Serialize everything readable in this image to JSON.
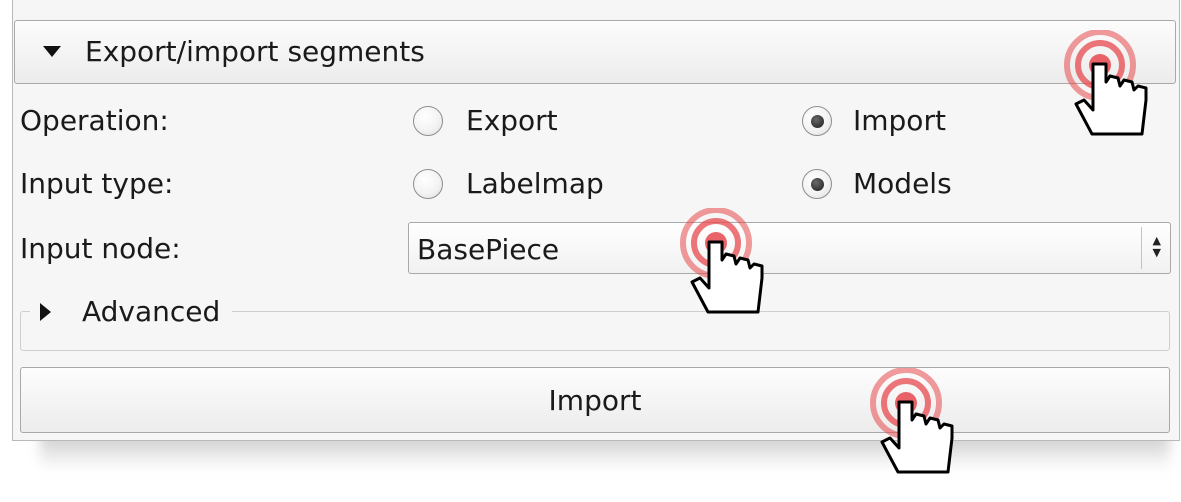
{
  "section": {
    "title": "Export/import segments"
  },
  "operation": {
    "label": "Operation:",
    "options": [
      {
        "label": "Export",
        "checked": false
      },
      {
        "label": "Import",
        "checked": true
      }
    ]
  },
  "input_type": {
    "label": "Input type:",
    "options": [
      {
        "label": "Labelmap",
        "checked": false
      },
      {
        "label": "Models",
        "checked": true
      }
    ]
  },
  "input_node": {
    "label": "Input node:",
    "value": "BasePiece"
  },
  "advanced": {
    "label": "Advanced"
  },
  "action_button": {
    "label": "Import"
  },
  "icons": {
    "collapse": "triangle-down-icon",
    "expand": "triangle-right-icon",
    "combo": "up-down-arrows-icon",
    "cursor": "hand-pointer-click-icon"
  },
  "colors": {
    "click_ring": "#e5484d",
    "panel_bg": "#f6f6f6"
  }
}
